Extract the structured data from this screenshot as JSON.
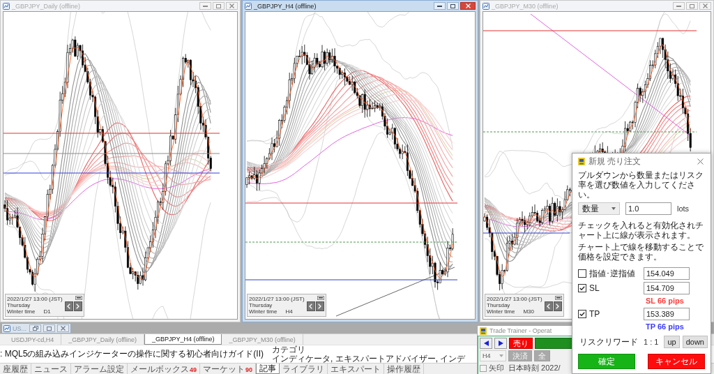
{
  "chart_windows": [
    {
      "title": "_GBPJPY_Daily (offline)",
      "active": false,
      "info": {
        "time": "2022/1/27 13:00 (JST)",
        "day": "Thursday",
        "season": "Winter time",
        "timeframe": "D1"
      }
    },
    {
      "title": "_GBPJPY_H4 (offline)",
      "active": true,
      "info": {
        "time": "2022/1/27 13:00 (JST)",
        "day": "Thursday",
        "season": "Winter time",
        "timeframe": "H4"
      }
    },
    {
      "title": "_GBPJPY_M30 (offline)",
      "active": false,
      "info": {
        "time": "2022/1/27 13:00 (JST)",
        "day": "Thursday",
        "season": "Winter time",
        "timeframe": "M30"
      }
    }
  ],
  "minimized_window": {
    "title": "US..."
  },
  "chart_tabs": [
    {
      "label": "USDJPY-cd,H4",
      "selected": false
    },
    {
      "label": "_GBPJPY_Daily (offline)",
      "selected": false
    },
    {
      "label": "_GBPJPY_H4 (offline)",
      "selected": true
    },
    {
      "label": "_GBPJPY_M30 (offline)",
      "selected": false
    }
  ],
  "article": {
    "title": ": MQL5の組み込みインジケーターの操作に関する初心者向けガイド(II)",
    "category_heading": "カテゴリ",
    "categories": "インディケータ, エキスパートアドバイザー, インデ"
  },
  "terminal_tabs": [
    {
      "label": "座履歴",
      "selected": false
    },
    {
      "label": "ニュース",
      "selected": false
    },
    {
      "label": "アラーム設定",
      "selected": false
    },
    {
      "label": "メールボックス",
      "badge": "49",
      "selected": false
    },
    {
      "label": "マーケット",
      "badge": "90",
      "selected": false
    },
    {
      "label": "記事",
      "selected": true
    },
    {
      "label": "ライブラリ",
      "selected": false
    },
    {
      "label": "エキスパート",
      "selected": false
    },
    {
      "label": "操作履歴",
      "selected": false
    }
  ],
  "trade_trainer": {
    "title": "Trade Trainer - Operat",
    "buttons": [
      {
        "kind": "prev"
      },
      {
        "kind": "next"
      },
      {
        "kind": "sell",
        "label": "売り"
      },
      {
        "kind": "buy"
      }
    ],
    "timeframe": "H4",
    "actions": [
      {
        "label": "決済",
        "disabled": true
      },
      {
        "label": "全",
        "disabled": true
      }
    ],
    "arrow_toggle": {
      "label": "矢印",
      "checked": false
    },
    "clock": "日本時刻 2022/"
  },
  "order_dialog": {
    "title": "新規 売り注文",
    "instruction": "プルダウンから数量またはリスク率を選び数値を入力してください。",
    "mode": "数量",
    "lots_value": "1.0",
    "lots_unit": "lots",
    "notes": [
      "チェックを入れると有効化されチャート上に線が表示されます。",
      "チャート上で線を移動することで価格を設定できます。"
    ],
    "levels": [
      {
        "label": "指値･逆指値",
        "checked": false,
        "value": "154.049"
      },
      {
        "label": "SL",
        "checked": true,
        "value": "154.709",
        "pips": "SL 66 pips",
        "color": "#ff3b3b"
      },
      {
        "label": "TP",
        "checked": true,
        "value": "153.389",
        "pips": "TP 66 pips",
        "color": "#3b3bff"
      }
    ],
    "risk_reward_label": "リスクリワード",
    "risk_reward": "1 : 1",
    "up_button": "up",
    "down_button": "down",
    "confirm_button": "確定",
    "cancel_button": "キャンセル"
  }
}
